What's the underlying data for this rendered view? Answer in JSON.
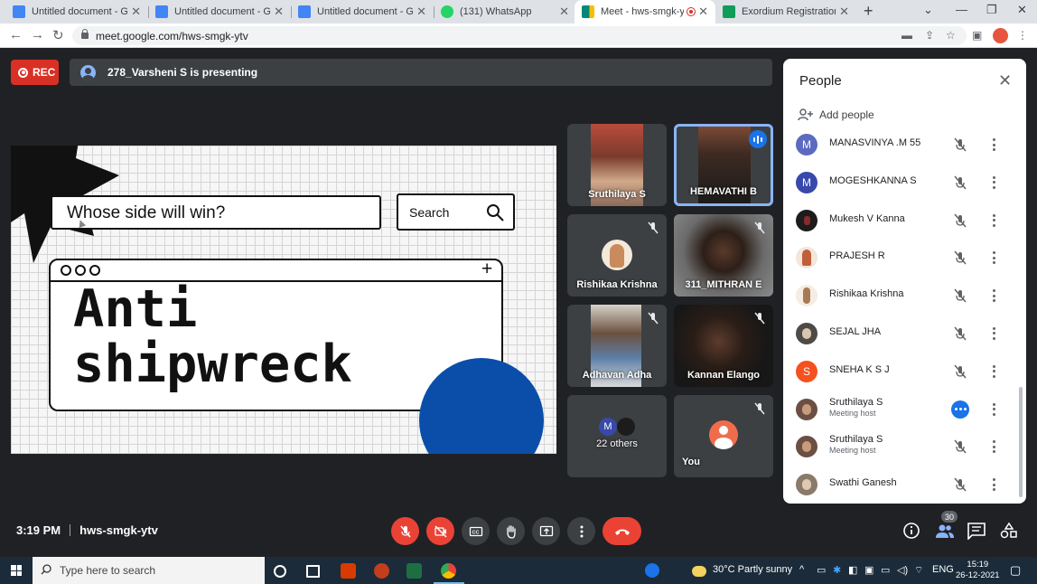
{
  "browser": {
    "tabs": [
      {
        "title": "Untitled document - Google Docs",
        "icon": "docs-icon",
        "color": "#4285f4"
      },
      {
        "title": "Untitled document - Google Docs",
        "icon": "docs-icon",
        "color": "#4285f4"
      },
      {
        "title": "Untitled document - Google Docs",
        "icon": "docs-icon",
        "color": "#4285f4"
      },
      {
        "title": "(131) WhatsApp",
        "icon": "whatsapp-icon",
        "color": "#25d366"
      },
      {
        "title": "Meet - hws-smgk-ytv",
        "icon": "meet-icon",
        "color": "#00897b",
        "active": true
      },
      {
        "title": "Exordium Registration form",
        "icon": "sheets-icon",
        "color": "#0f9d58"
      }
    ],
    "url": "meet.google.com/hws-smgk-ytv"
  },
  "meet": {
    "rec_label": "REC",
    "presenting_text": "278_Varsheni S is presenting",
    "slide": {
      "search_text": "Whose side will win?",
      "search_button": "Search",
      "headline_line1": "Anti",
      "headline_line2": "shipwreck"
    },
    "tiles": [
      {
        "name": "Sruthilaya S"
      },
      {
        "name": "HEMAVATHI B"
      },
      {
        "name": "Rishikaa Krishna"
      },
      {
        "name": "311_MITHRAN E"
      },
      {
        "name": "Adhavan Adha"
      },
      {
        "name": "Kannan Elango"
      },
      {
        "name": "22 others",
        "avatar_letter": "M"
      },
      {
        "name": "You"
      }
    ],
    "time": "3:19 PM",
    "meeting_code": "hws-smgk-ytv",
    "participant_count": "30"
  },
  "people_panel": {
    "title": "People",
    "add_people": "Add people",
    "participants": [
      {
        "name": "MANASVINYA .M 55",
        "letter": "M",
        "color": "#5c6bc0"
      },
      {
        "name": "MOGESHKANNA S",
        "letter": "M",
        "color": "#3949ab"
      },
      {
        "name": "Mukesh V Kanna",
        "letter": "",
        "color": "#1c1c1c"
      },
      {
        "name": "PRAJESH R",
        "letter": "",
        "color": "#c0603a"
      },
      {
        "name": "Rishikaa Krishna",
        "letter": "",
        "color": "#e9dcc8"
      },
      {
        "name": "SEJAL JHA",
        "letter": "",
        "color": "#4e4a45"
      },
      {
        "name": "SNEHA K S J",
        "letter": "S",
        "color": "#f4511e"
      },
      {
        "name": "Sruthilaya S",
        "subtitle": "Meeting host",
        "letter": "",
        "color": "#6b4f43",
        "speaking": true
      },
      {
        "name": "Sruthilaya S",
        "subtitle": "Meeting host",
        "letter": "",
        "color": "#6b4f43"
      },
      {
        "name": "Swathi Ganesh",
        "letter": "",
        "color": "#8a7a6a"
      }
    ]
  },
  "taskbar": {
    "search_placeholder": "Type here to search",
    "weather": "30°C  Partly sunny",
    "language": "ENG",
    "clock_time": "15:19",
    "clock_date": "26-12-2021"
  }
}
